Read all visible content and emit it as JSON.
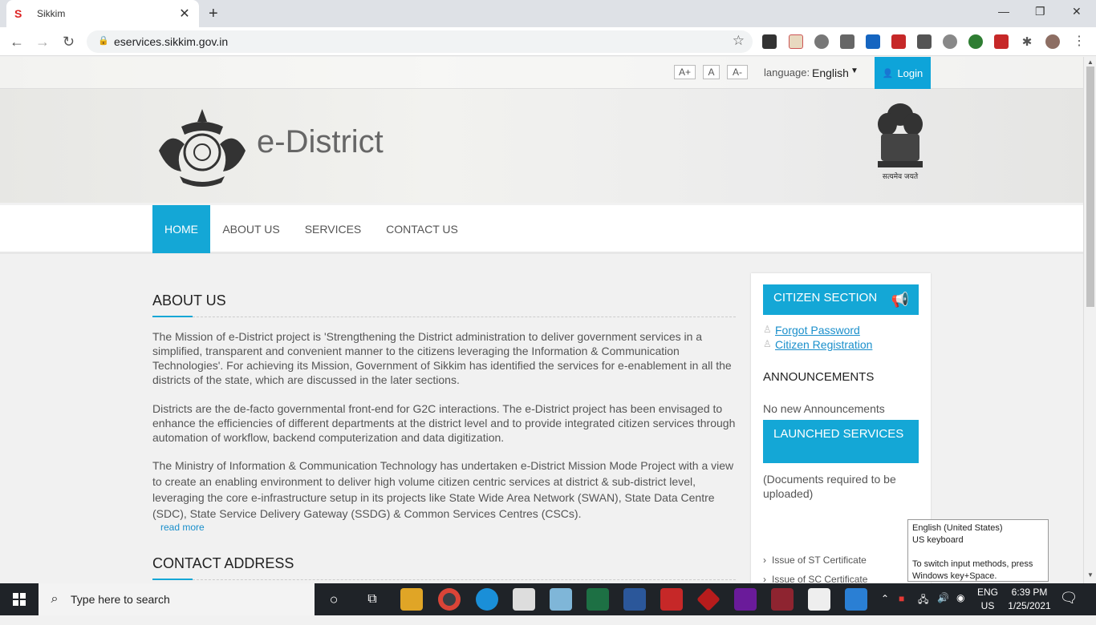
{
  "browser": {
    "tab_title": "Sikkim",
    "tab_favicon": "S",
    "url": "eservices.sikkim.gov.in",
    "new_tab": "+",
    "close_tab": "✕",
    "minimize": "—",
    "maximize": "❐",
    "close": "✕"
  },
  "site": {
    "font_sizes": [
      "A+",
      "A",
      "A-"
    ],
    "language_label": "language:",
    "language_value": "English",
    "login_label": "Login",
    "brand": "e-District",
    "emblem_motto": "सत्यमेव जयते",
    "nav": [
      "HOME",
      "ABOUT US",
      "SERVICES",
      "CONTACT US"
    ],
    "about_title": "ABOUT US",
    "about_paragraphs": [
      "The Mission of e-District project is 'Strengthening the District administration to deliver government services in a simplified, transparent and convenient manner to the citizens leveraging the Information & Communication Technologies'. For achieving its Mission, Government of Sikkim has identified the services for e-enablement in all the districts of the state, which are discussed in the later sections.",
      "Districts are the de-facto governmental front-end for G2C interactions. The e-District project has been envisaged to enhance the efficiencies of different departments at the district level and to provide integrated citizen services through automation of workflow, backend computerization and data digitization.",
      "The Ministry of Information & Communication Technology has undertaken e-District Mission Mode Project with a view to create an enabling environment to deliver high volume citizen centric services at district & sub-district level, leveraging the core e-infrastructure setup in its projects like State Wide Area Network (SWAN), State Data Centre (SDC), State Service Delivery Gateway (SSDG) & Common Services Centres (CSCs)."
    ],
    "read_more": "read more",
    "contact_title": "CONTACT ADDRESS",
    "sidebar": {
      "citizen_section": "CITIZEN SECTION",
      "links": [
        "Forgot Password",
        "Citizen Registration"
      ],
      "announcements_title": "ANNOUNCEMENTS",
      "announcements_empty": "No new Announcements",
      "launched_services": "LAUNCHED SERVICES",
      "documents_note": "(Documents required to be uploaded)",
      "services": [
        "Issue of ST Certificate",
        "Issue of SC Certificate"
      ]
    }
  },
  "tooltip": {
    "line1": "English (United States)",
    "line2": "US keyboard",
    "line3": "To switch input methods, press Windows key+Space."
  },
  "taskbar": {
    "search_placeholder": "Type here to search",
    "ime_top": "ENG",
    "ime_bottom": "US",
    "time": "6:39 PM",
    "date": "1/25/2021"
  },
  "colors": {
    "accent": "#14a7d6",
    "link": "#1a8fcb"
  }
}
